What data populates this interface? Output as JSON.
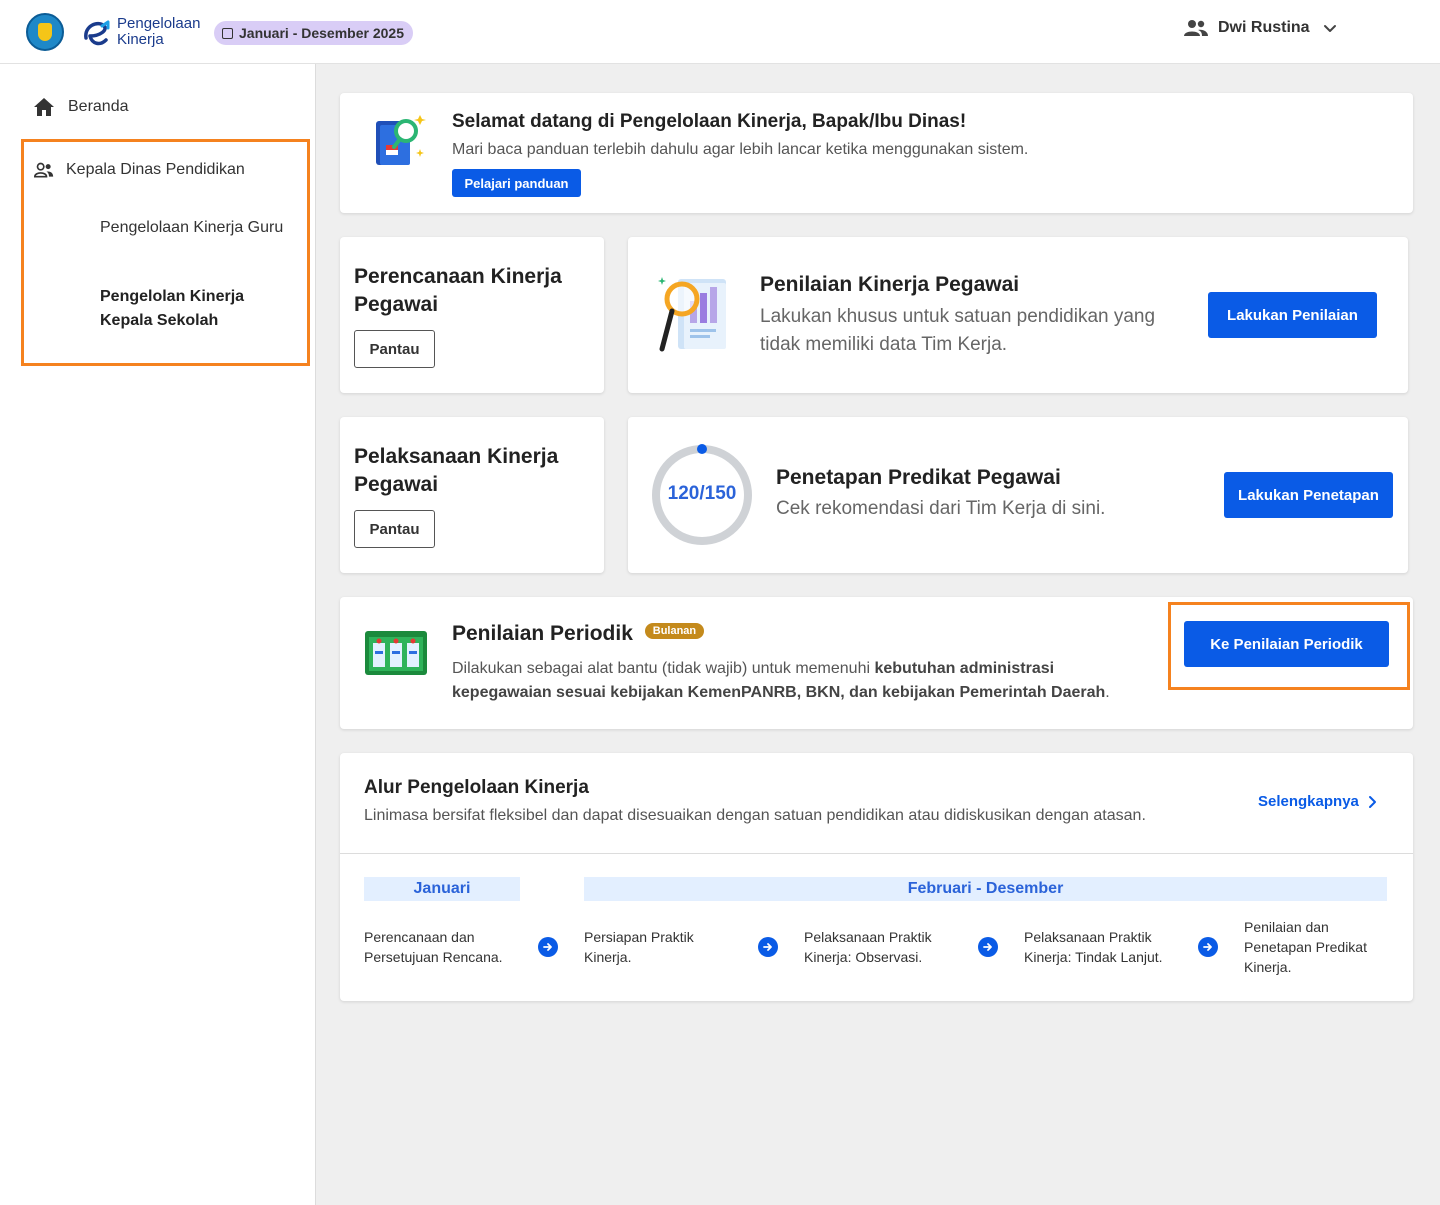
{
  "header": {
    "brand_line1": "Pengelolaan",
    "brand_line2": "Kinerja",
    "period": "Januari - Desember 2025",
    "user_name": "Dwi Rustina"
  },
  "sidebar": {
    "home_label": "Beranda",
    "group_label": "Kepala Dinas Pendidikan",
    "items": [
      {
        "label": "Pengelolaan Kinerja Guru"
      },
      {
        "label": "Pengelolan Kinerja Kepala Sekolah"
      }
    ]
  },
  "welcome": {
    "title": "Selamat datang di Pengelolaan Kinerja, Bapak/Ibu Dinas!",
    "desc": "Mari baca panduan terlebih dahulu agar lebih lancar ketika menggunakan sistem.",
    "button": "Pelajari panduan"
  },
  "perencanaan": {
    "title": "Perencanaan Kinerja Pegawai",
    "button": "Pantau"
  },
  "pelaksanaan": {
    "title": "Pelaksanaan Kinerja Pegawai",
    "button": "Pantau"
  },
  "penilaian": {
    "title": "Penilaian Kinerja Pegawai",
    "desc": "Lakukan khusus untuk satuan pendidikan yang tidak memiliki data Tim Kerja.",
    "button": "Lakukan Penilaian"
  },
  "penetapan": {
    "progress_text": "120/150",
    "progress_value": 0.8,
    "title": "Penetapan Predikat Pegawai",
    "desc": "Cek rekomendasi dari Tim Kerja di sini.",
    "button": "Lakukan Penetapan"
  },
  "periodik": {
    "title": "Penilaian Periodik",
    "badge": "Bulanan",
    "desc_plain": "Dilakukan sebagai alat bantu (tidak wajib) untuk memenuhi ",
    "desc_bold": "kebutuhan administrasi kepegawaian sesuai kebijakan KemenPANRB, BKN, dan kebijakan Pemerintah Daerah",
    "desc_end": ".",
    "button": "Ke Penilaian Periodik"
  },
  "alur": {
    "title": "Alur Pengelolaan Kinerja",
    "desc": "Linimasa bersifat fleksibel dan dapat disesuaikan dengan satuan pendidikan atau didiskusikan dengan atasan.",
    "link": "Selengkapnya",
    "month1": "Januari",
    "month2": "Februari - Desember",
    "steps": [
      {
        "label": "Perencanaan dan Persetujuan Rencana."
      },
      {
        "label": "Persiapan Praktik Kinerja."
      },
      {
        "label": "Pelaksanaan Praktik Kinerja: Observasi."
      },
      {
        "label": "Pelaksanaan Praktik Kinerja: Tindak Lanjut."
      },
      {
        "label": "Penilaian dan Penetapan Predikat Kinerja."
      }
    ]
  },
  "colors": {
    "primary": "#0a5be6",
    "highlight": "#f5821f",
    "badge": "#c48a1c",
    "chip": "#d9cdf6"
  }
}
